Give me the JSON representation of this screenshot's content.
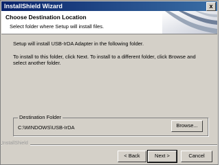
{
  "window": {
    "title": "InstallShield Wizard",
    "close_label": "x"
  },
  "header": {
    "title": "Choose Destination Location",
    "subtitle": "Select folder where Setup will install files."
  },
  "body": {
    "line1": "Setup will install USB-IrDA Adapter in the following folder.",
    "line2": "To install to this folder, click Next. To install to a different folder, click Browse and select another folder."
  },
  "destination": {
    "group_label": "Destination Folder",
    "path": "C:\\WINDOWS\\USB-IrDA",
    "browse_label": "Browse..."
  },
  "footer": {
    "brand": "InstallShield",
    "back_label": "< Back",
    "next_label": "Next >",
    "cancel_label": "Cancel"
  },
  "colors": {
    "titlebar_start": "#0a246a",
    "titlebar_end": "#3a6ea5",
    "dialog_bg": "#d4d0c8"
  }
}
